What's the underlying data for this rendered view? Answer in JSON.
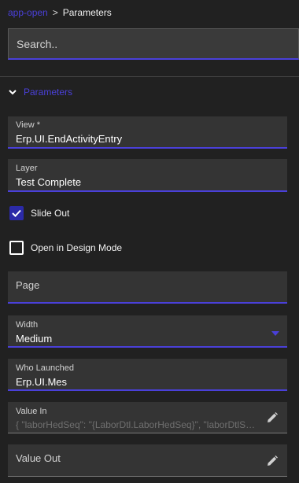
{
  "breadcrumb": {
    "parent": "app-open",
    "separator": ">",
    "current": "Parameters"
  },
  "search": {
    "placeholder": "Search.."
  },
  "section": {
    "label": "Parameters",
    "expanded": true
  },
  "fields": {
    "view": {
      "label": "View *",
      "value": "Erp.UI.EndActivityEntry"
    },
    "layer": {
      "label": "Layer",
      "value": "Test Complete"
    },
    "page": {
      "label": "Page",
      "value": ""
    },
    "width": {
      "label": "Width",
      "value": "Medium"
    },
    "who_launched": {
      "label": "Who Launched",
      "value": "Erp.UI.Mes"
    },
    "value_in": {
      "label": "Value In",
      "value": "{ \"laborHedSeq\": \"{LaborDtl.LaborHedSeq}\", \"laborDtlSeq\": \"{LaborDtl.LaborDtlSeq}\" }"
    },
    "value_out": {
      "label": "Value Out",
      "value": ""
    }
  },
  "checkboxes": {
    "slide_out": {
      "label": "Slide Out",
      "checked": true
    },
    "design_mode": {
      "label": "Open in Design Mode",
      "checked": false
    }
  },
  "colors": {
    "accent": "#4a40d9",
    "background": "#212121",
    "field": "#343434",
    "checkbox": "#2b2aa8"
  },
  "icons": {
    "section_toggle": "chevron-down-icon",
    "edit": "pencil-icon",
    "dropdown": "caret-down-icon",
    "check": "check-icon"
  }
}
